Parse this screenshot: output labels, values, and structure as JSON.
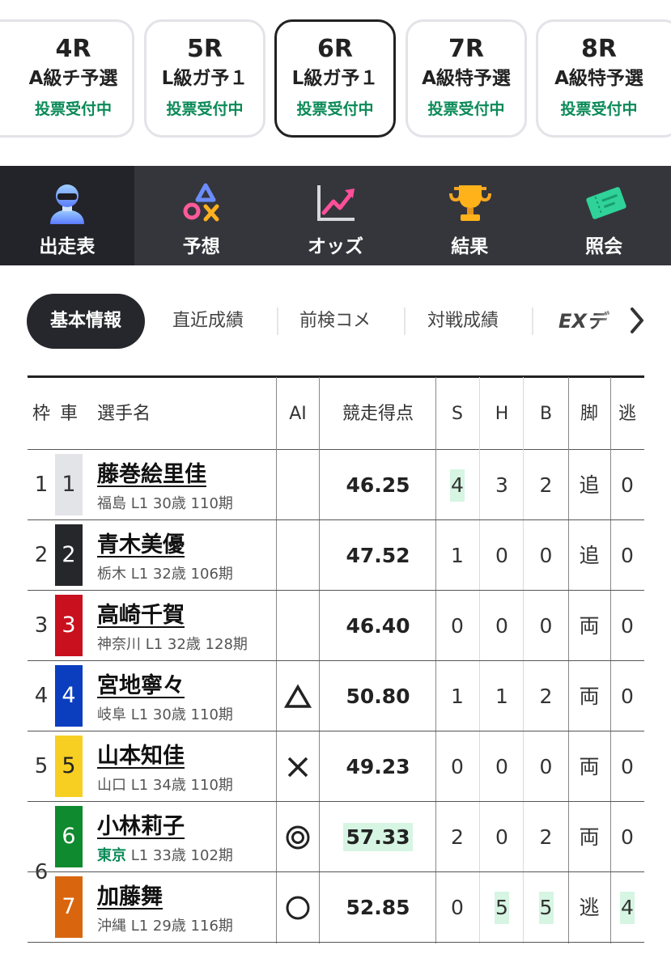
{
  "races": [
    {
      "num": "4R",
      "class": "A級チ予選",
      "status": "投票受付中",
      "active": false
    },
    {
      "num": "5R",
      "class": "L級ガ予１",
      "status": "投票受付中",
      "active": false
    },
    {
      "num": "6R",
      "class": "L級ガ予１",
      "status": "投票受付中",
      "active": true
    },
    {
      "num": "7R",
      "class": "A級特予選",
      "status": "投票受付中",
      "active": false
    },
    {
      "num": "8R",
      "class": "A級特予選",
      "status": "投票受付中",
      "active": false
    }
  ],
  "nav": [
    {
      "label": "出走表",
      "icon": "racer-icon"
    },
    {
      "label": "予想",
      "icon": "prediction-icon"
    },
    {
      "label": "オッズ",
      "icon": "odds-chart-icon"
    },
    {
      "label": "結果",
      "icon": "trophy-icon"
    },
    {
      "label": "照会",
      "icon": "ticket-icon"
    }
  ],
  "sub_tabs": [
    "基本情報",
    "直近成績",
    "前検コメ",
    "対戦成績",
    "EXデ"
  ],
  "table": {
    "headers": {
      "frame": "枠",
      "car": "車",
      "name": "選手名",
      "ai": "AI",
      "points": "競走得点",
      "s": "S",
      "h": "H",
      "b": "B",
      "leg": "脚",
      "escape": "逃"
    },
    "rows": [
      {
        "frame": "1",
        "car": "1",
        "name": "藤巻絵里佳",
        "pref": "福島",
        "info": "L1 30歳 110期",
        "ai": "",
        "points": "46.25",
        "s": "4",
        "h": "3",
        "b": "2",
        "leg": "追",
        "escape": "0"
      },
      {
        "frame": "2",
        "car": "2",
        "name": "青木美優",
        "pref": "栃木",
        "info": "L1 32歳 106期",
        "ai": "",
        "points": "47.52",
        "s": "1",
        "h": "0",
        "b": "0",
        "leg": "追",
        "escape": "0"
      },
      {
        "frame": "3",
        "car": "3",
        "name": "高崎千賀",
        "pref": "神奈川",
        "info": "L1 32歳 128期",
        "ai": "",
        "points": "46.40",
        "s": "0",
        "h": "0",
        "b": "0",
        "leg": "両",
        "escape": "0"
      },
      {
        "frame": "4",
        "car": "4",
        "name": "宮地寧々",
        "pref": "岐阜",
        "info": "L1 30歳 110期",
        "ai": "triangle",
        "points": "50.80",
        "s": "1",
        "h": "1",
        "b": "2",
        "leg": "両",
        "escape": "0"
      },
      {
        "frame": "5",
        "car": "5",
        "name": "山本知佳",
        "pref": "山口",
        "info": "L1 34歳 110期",
        "ai": "cross",
        "points": "49.23",
        "s": "0",
        "h": "0",
        "b": "0",
        "leg": "両",
        "escape": "0"
      },
      {
        "frame": "6",
        "car": "6",
        "name": "小林莉子",
        "pref": "東京",
        "info": "L1 33歳 102期",
        "ai": "double-circle",
        "points": "57.33",
        "s": "2",
        "h": "0",
        "b": "2",
        "leg": "両",
        "escape": "0"
      },
      {
        "frame": "6",
        "car": "7",
        "name": "加藤舞",
        "pref": "沖縄",
        "info": "L1 29歳 116期",
        "ai": "circle",
        "points": "52.85",
        "s": "0",
        "h": "5",
        "b": "5",
        "leg": "逃",
        "escape": "4"
      }
    ]
  },
  "colors": {
    "accent_green": "#0a8a57",
    "highlight_bg": "#d6f5e3",
    "nav_bg": "#35363b",
    "car_1": "#e3e4e8",
    "car_2": "#26272b",
    "car_3": "#c8101e",
    "car_4": "#0b3ebf",
    "car_5": "#f7cf22",
    "car_6": "#0f8a2e",
    "car_7": "#d9660f"
  }
}
